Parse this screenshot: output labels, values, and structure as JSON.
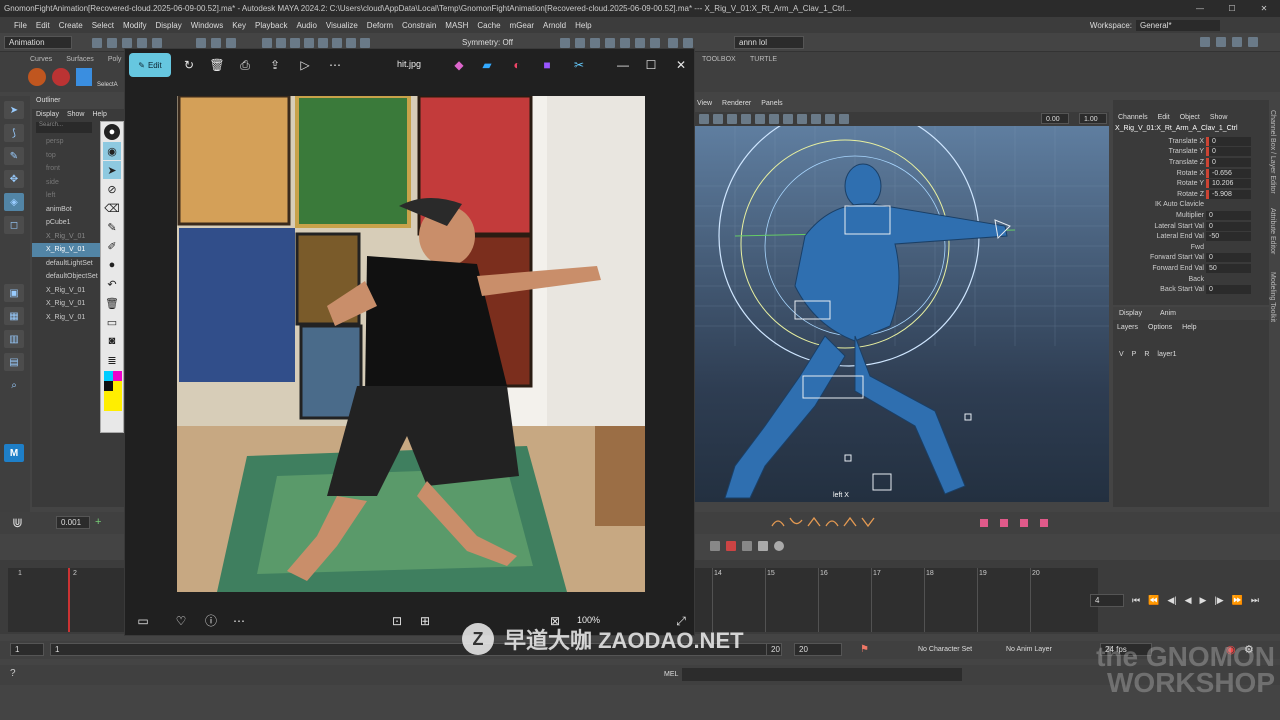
{
  "titlebar": {
    "title": "GnomonFightAnimation[Recovered-cloud.2025-06-09-00.52].ma* - Autodesk MAYA 2024.2: C:\\Users\\cloud\\AppData\\Local\\Temp\\GnomonFightAnimation[Recovered-cloud.2025-06-09-00.52].ma* --- X_Rig_V_01:X_Rt_Arm_A_Clav_1_Ctrl...",
    "minimize": "—",
    "maximize": "☐",
    "close": "✕"
  },
  "menubar": {
    "items": [
      "File",
      "Edit",
      "Create",
      "Select",
      "Modify",
      "Display",
      "Windows",
      "Key",
      "Playback",
      "Audio",
      "Visualize",
      "Deform",
      "Constrain",
      "MASH",
      "Cache",
      "mGear",
      "Arnold",
      "Help"
    ],
    "workspace_label": "Workspace:",
    "workspace_value": "General*"
  },
  "statusline": {
    "menuset": "Animation",
    "symmetry": "Symmetry: Off",
    "user": "annn lol"
  },
  "shelf": {
    "tabs": [
      "Curves",
      "Surfaces",
      "Poly"
    ],
    "right_tabs": [
      "TOOLBOX",
      "TURTLE"
    ],
    "select_label": "SelectA"
  },
  "outliner": {
    "title": "Outliner",
    "menu": [
      "Display",
      "Show",
      "Help"
    ],
    "search_placeholder": "Search...",
    "rows": [
      "persp",
      "top",
      "front",
      "side",
      "left",
      "animBot",
      "pCube1",
      "X_Rig_V_01",
      "X_Rig_V_01",
      "defaultLightSet",
      "defaultObjectSet",
      "X_Rig_V_01",
      "X_Rig_V_01",
      "X_Rig_V_01"
    ]
  },
  "viewer": {
    "edit_label": "Edit",
    "filename": "hit.jpg",
    "zoom": "100%"
  },
  "viewport": {
    "menu": [
      "View",
      "Renderer",
      "Panels"
    ],
    "value_a": "0.00",
    "value_b": "1.00",
    "camera_label": "left X"
  },
  "channels": {
    "menu": [
      "Channels",
      "Edit",
      "Object",
      "Show"
    ],
    "object": "X_Rig_V_01:X_Rt_Arm_A_Clav_1_Ctrl",
    "attrs": [
      {
        "name": "Translate X",
        "value": "0"
      },
      {
        "name": "Translate Y",
        "value": "0"
      },
      {
        "name": "Translate Z",
        "value": "0"
      },
      {
        "name": "Rotate X",
        "value": "-0.656"
      },
      {
        "name": "Rotate Y",
        "value": "10.206"
      },
      {
        "name": "Rotate Z",
        "value": "-5.908"
      },
      {
        "name": "IK Auto Clavicle",
        "value": ""
      },
      {
        "name": "Multiplier",
        "value": "0"
      },
      {
        "name": "Lateral Start Val",
        "value": "0"
      },
      {
        "name": "Lateral End Val",
        "value": "-50"
      },
      {
        "name": "Fwd",
        "value": ""
      },
      {
        "name": "Forward Start Val",
        "value": "0"
      },
      {
        "name": "Forward End Val",
        "value": "50"
      },
      {
        "name": "Back",
        "value": ""
      },
      {
        "name": "Back Start Val",
        "value": "0"
      }
    ]
  },
  "layers": {
    "tabs": [
      "Display",
      "Anim"
    ],
    "menu": [
      "Layers",
      "Options",
      "Help"
    ],
    "layer_flags": [
      "V",
      "P",
      "R"
    ],
    "layer_name": "layer1"
  },
  "side_tabs": [
    "Channel Box / Layer Editor",
    "Attribute Editor",
    "Modeling Toolkit"
  ],
  "timeline": {
    "step_value": "0.001",
    "left_ticks": [
      "1",
      "2"
    ],
    "ticks": [
      "14",
      "15",
      "16",
      "17",
      "18",
      "19",
      "20"
    ],
    "current_frame": "4"
  },
  "range": {
    "start": "1",
    "inner_start": "1",
    "inner_end": "20",
    "end": "20",
    "character_set": "No Character Set",
    "anim_layer": "No Anim Layer",
    "fps": "24 fps"
  },
  "cmdline": {
    "label": "MEL"
  },
  "watermark": {
    "logo": "Z",
    "text": "早道大咖 ZAODAO.NET"
  },
  "brand": {
    "line1": "the GNOMON",
    "line2": "WORKSHOP"
  }
}
